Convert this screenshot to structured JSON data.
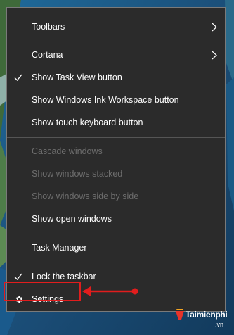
{
  "menu": {
    "items": [
      {
        "label": "Toolbars",
        "submenu": true
      },
      {
        "label": "Cortana",
        "submenu": true
      },
      {
        "label": "Show Task View button",
        "checked": true
      },
      {
        "label": "Show Windows Ink Workspace button"
      },
      {
        "label": "Show touch keyboard button"
      },
      {
        "label": "Cascade windows",
        "disabled": true
      },
      {
        "label": "Show windows stacked",
        "disabled": true
      },
      {
        "label": "Show windows side by side",
        "disabled": true
      },
      {
        "label": "Show open windows"
      },
      {
        "label": "Task Manager"
      },
      {
        "label": "Lock the taskbar",
        "checked": true
      },
      {
        "label": "Settings",
        "icon": "gear-icon"
      }
    ]
  },
  "annotation": {
    "target": "Settings",
    "color": "#e11d1d"
  },
  "watermark": {
    "brand": "Taimienphi",
    "domain": ".vn"
  },
  "colors": {
    "menu_bg": "#2b2b2b",
    "text": "#ffffff",
    "disabled_text": "#6d6d6d",
    "highlight": "#e11d1d"
  }
}
